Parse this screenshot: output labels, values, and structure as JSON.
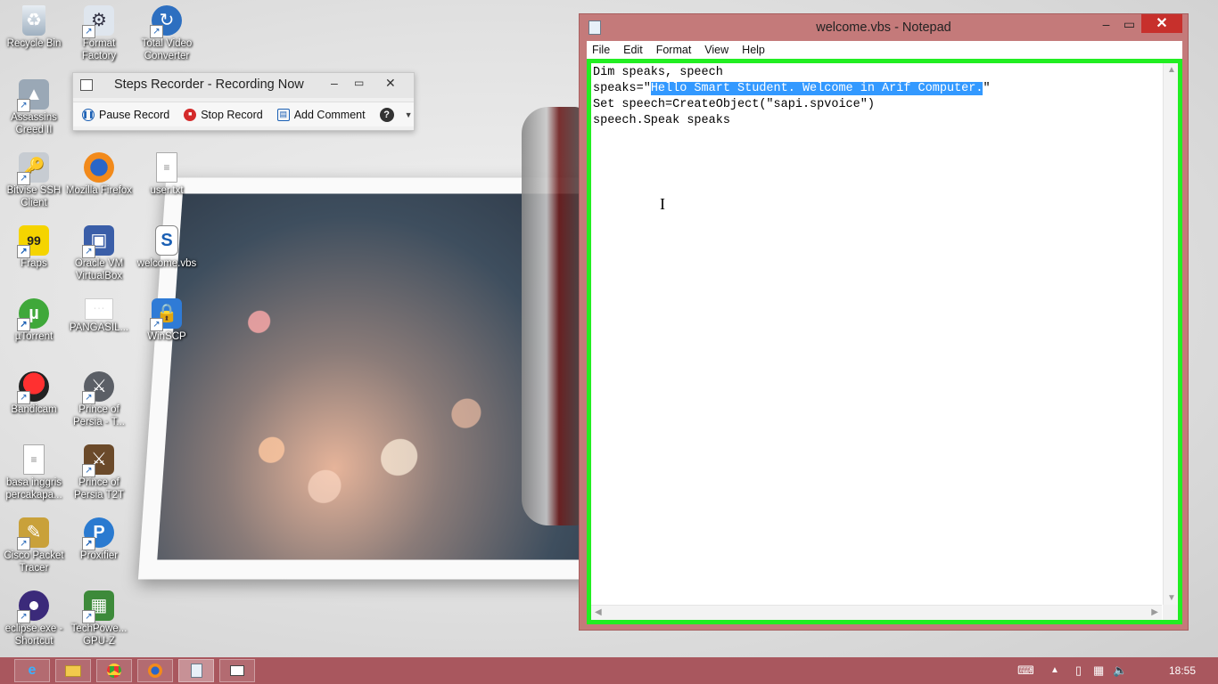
{
  "desktop": {
    "icons": [
      {
        "label": "Recycle Bin",
        "icon": "recycle-bin-icon"
      },
      {
        "label": "Format Factory",
        "icon": "format-factory-icon"
      },
      {
        "label": "Total Video Converter",
        "icon": "total-video-converter-icon"
      },
      {
        "label": "Assassins Creed II",
        "icon": "assassins-creed-icon"
      },
      {
        "label": "Bitvise SSH Client",
        "icon": "bitvise-icon"
      },
      {
        "label": "Mozilla Firefox",
        "icon": "firefox-icon"
      },
      {
        "label": "user.txt",
        "icon": "text-file-icon"
      },
      {
        "label": "Fraps",
        "icon": "fraps-icon"
      },
      {
        "label": "Oracle VM VirtualBox",
        "icon": "virtualbox-icon"
      },
      {
        "label": "welcome.vbs",
        "icon": "vbs-script-icon"
      },
      {
        "label": "µTorrent",
        "icon": "utorrent-icon"
      },
      {
        "label": "PANGASIL...",
        "icon": "document-thumbnail-icon"
      },
      {
        "label": "WinSCP",
        "icon": "winscp-icon"
      },
      {
        "label": "Bandicam",
        "icon": "bandicam-icon"
      },
      {
        "label": "Prince of Persia - T...",
        "icon": "prince-of-persia-icon"
      },
      {
        "label": "basa inggris percakapa...",
        "icon": "text-file-icon"
      },
      {
        "label": "Prince of Persia T2T",
        "icon": "prince-of-persia-icon"
      },
      {
        "label": "Cisco Packet Tracer",
        "icon": "cisco-packet-tracer-icon"
      },
      {
        "label": "Proxifier",
        "icon": "proxifier-icon"
      },
      {
        "label": "eclipse.exe - Shortcut",
        "icon": "eclipse-icon"
      },
      {
        "label": "TechPowe... GPU-Z",
        "icon": "gpu-z-icon"
      }
    ]
  },
  "steps_recorder": {
    "title": "Steps Recorder - Recording Now",
    "pause_label": "Pause Record",
    "stop_label": "Stop Record",
    "comment_label": "Add Comment"
  },
  "notepad": {
    "title": "welcome.vbs - Notepad",
    "menu": [
      "File",
      "Edit",
      "Format",
      "View",
      "Help"
    ],
    "lines": {
      "l1": "Dim speaks, speech",
      "l2_prefix": "speaks=\"",
      "l2_selected": "Hello Smart Student. Welcome in Arif Computer.",
      "l2_suffix": "\"",
      "l3": "Set speech=CreateObject(\"sapi.spvoice\")",
      "l4": "speech.Speak speaks"
    },
    "highlight_color": "#22ee22"
  },
  "taskbar": {
    "apps": [
      "internet-explorer-icon",
      "file-explorer-icon",
      "chrome-icon",
      "firefox-icon",
      "notepad-icon",
      "steps-recorder-icon"
    ],
    "active_app": "notepad-icon",
    "clock": "18:55",
    "color": "#a9575e"
  }
}
